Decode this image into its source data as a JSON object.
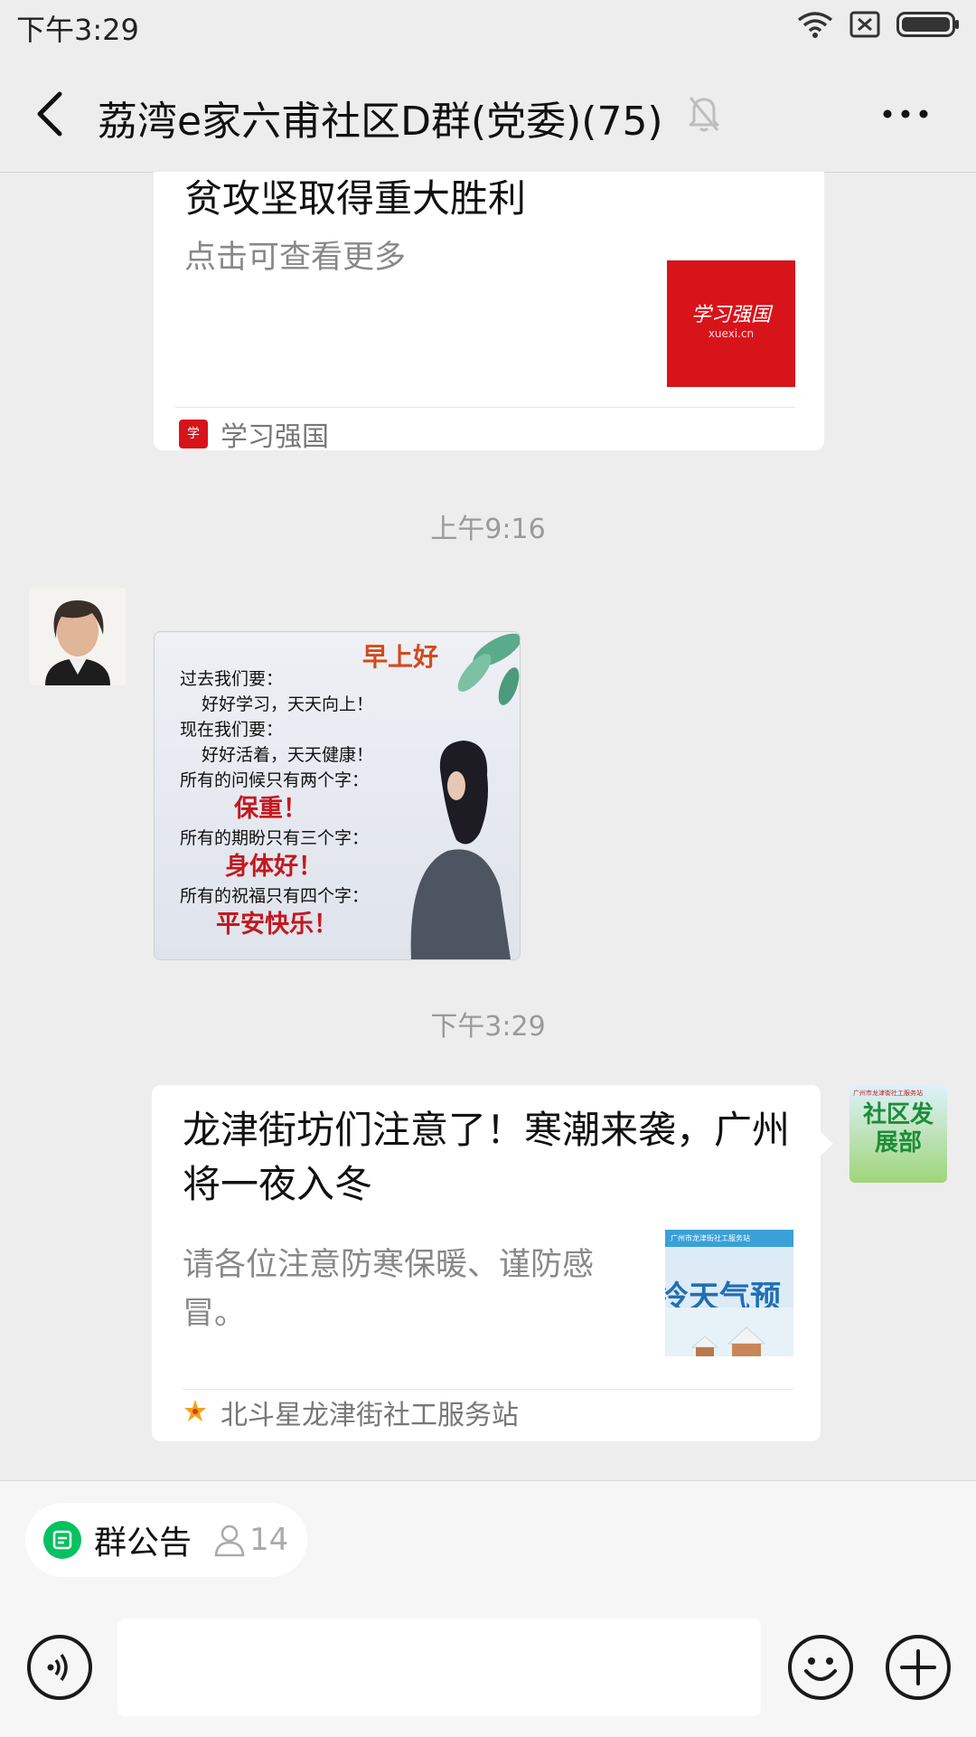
{
  "status_bar": {
    "time": "下午3:29",
    "icons": [
      "wifi-icon",
      "sim-off-icon",
      "battery-icon"
    ]
  },
  "header": {
    "title": "荔湾e家六甫社区D群(党委)(75)",
    "back_icon": "chevron-left-icon",
    "mute_icon": "bell-off-icon",
    "more_icon": "more-dots-icon"
  },
  "messages": [
    {
      "type": "article_card",
      "headline": "贫攻坚取得重大胜利",
      "description": "点击可查看更多",
      "thumbnail_text": "学习强国",
      "thumbnail_subtext": "xuexi.cn",
      "source": "学习强国",
      "accent": "#d7141a"
    },
    {
      "type": "timestamp",
      "text": "上午9:16"
    },
    {
      "type": "image",
      "header_text": "早上好",
      "lines": [
        "过去我们要：",
        "好好学习，天天向上！",
        "现在我们要：",
        "好好活着，天天健康！",
        "所有的问候只有两个字：",
        "保重！",
        "所有的期盼只有三个字：",
        "身体好！",
        "所有的祝福只有四个字：",
        "平安快乐！"
      ]
    },
    {
      "type": "timestamp",
      "text": "下午3:29"
    },
    {
      "type": "article_card",
      "headline": "龙津街坊们注意了！寒潮来袭，广州将一夜入冬",
      "description": "请各位注意防寒保暖、谨防感冒。",
      "thumbnail_text": "冷天气预",
      "thumbnail_banner": "广州市龙津街社工服务站",
      "source": "北斗星龙津街社工服务站",
      "avatar_banner": "广州市龙津街社工服务站",
      "avatar_text": "社区发展部"
    }
  ],
  "bottom": {
    "notice_label": "群公告",
    "notice_count": "14",
    "icons": [
      "voice-icon",
      "emoji-icon",
      "plus-icon"
    ],
    "accent_green": "#07c160"
  }
}
